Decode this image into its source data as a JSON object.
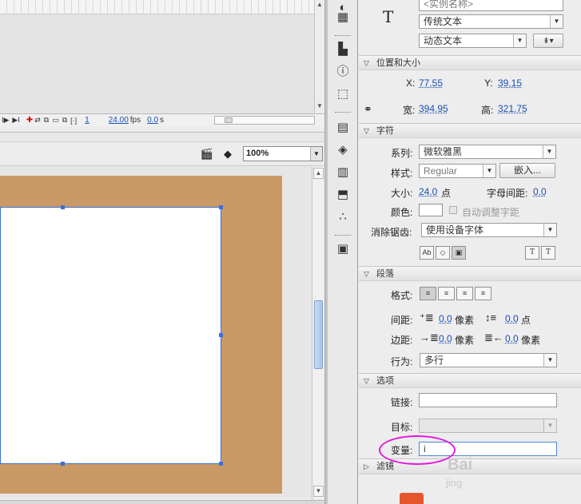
{
  "timeline": {
    "frame_number": "1",
    "fps_value": "24.00",
    "fps_unit": "fps",
    "time_value": "0.0",
    "time_unit": "s"
  },
  "stage": {
    "zoom": "100%"
  },
  "properties": {
    "text_tool_icon": "T",
    "instance_name_placeholder": "<实例名称>",
    "text_engine": "传统文本",
    "text_type": "动态文本",
    "position_section": {
      "title": "位置和大小",
      "x_label": "X:",
      "x_value": "77.55",
      "y_label": "Y:",
      "y_value": "39.15",
      "width_label": "宽:",
      "width_value": "394.95",
      "height_label": "高:",
      "height_value": "321.75"
    },
    "character_section": {
      "title": "字符",
      "family_label": "系列:",
      "family_value": "微软雅黑",
      "style_label": "样式:",
      "style_value": "Regular",
      "embed_button": "嵌入...",
      "size_label": "大小:",
      "size_value": "24.0",
      "size_unit": "点",
      "letter_spacing_label": "字母间距:",
      "letter_spacing_value": "0.0",
      "color_label": "颜色:",
      "auto_kern_label": "自动调整字距",
      "antialias_label": "消除锯齿:",
      "antialias_value": "使用设备字体"
    },
    "paragraph_section": {
      "title": "段落",
      "format_label": "格式:",
      "spacing_label": "间距:",
      "indent_value": "0.0",
      "indent_unit": "像素",
      "line_spacing_value": "0.0",
      "line_spacing_unit": "点",
      "margins_label": "边距:",
      "left_margin_value": "0.0",
      "left_margin_unit": "像素",
      "right_margin_value": "0.0",
      "right_margin_unit": "像素",
      "behavior_label": "行为:",
      "behavior_value": "多行"
    },
    "options_section": {
      "title": "选项",
      "link_label": "链接:",
      "link_value": "",
      "target_label": "目标:",
      "variable_label": "变量:",
      "variable_value": "i"
    },
    "filters_section": {
      "title": "滤镜"
    }
  },
  "watermark": {
    "line1": "Bai",
    "line2": "jing"
  },
  "colors": {
    "pasteboard": "#c99a66",
    "selection": "#3d6fd6",
    "highlight": "#e21ae0",
    "link": "#1a4fb3"
  }
}
